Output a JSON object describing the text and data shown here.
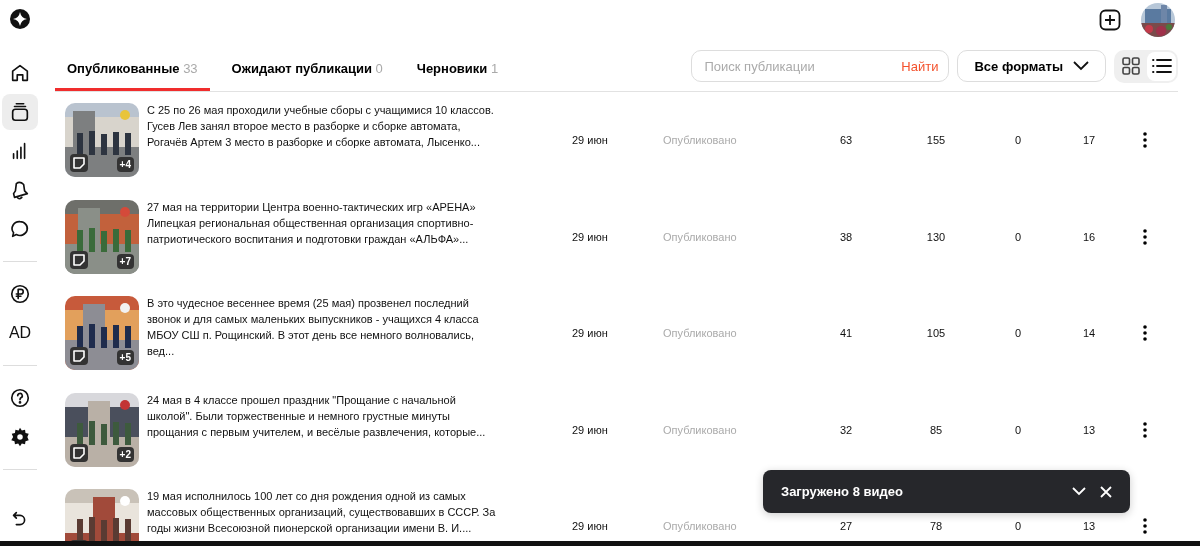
{
  "sidebar": {
    "groups": [
      {
        "items": [
          {
            "kind": "home",
            "selected": false
          },
          {
            "kind": "posts",
            "selected": true
          },
          {
            "kind": "stats",
            "selected": false
          },
          {
            "kind": "bell",
            "selected": false
          },
          {
            "kind": "chat",
            "selected": false
          }
        ]
      },
      {
        "items": [
          {
            "kind": "ruble",
            "selected": false
          },
          {
            "kind": "text",
            "label": "AD",
            "selected": false
          }
        ]
      },
      {
        "items": [
          {
            "kind": "help",
            "selected": false
          },
          {
            "kind": "settings",
            "selected": false
          }
        ]
      },
      {
        "items": [
          {
            "kind": "undo",
            "selected": false
          }
        ]
      }
    ]
  },
  "tabs": [
    {
      "label": "Опубликованные",
      "count": "33",
      "selected": true
    },
    {
      "label": "Ожидают публикации",
      "count": "0",
      "selected": false
    },
    {
      "label": "Черновики",
      "count": "1",
      "selected": false
    }
  ],
  "search": {
    "placeholder": "Поиск публикации",
    "button": "Найти"
  },
  "format_filter": {
    "label": "Все форматы"
  },
  "view_toggle": [
    {
      "kind": "grid",
      "selected": false
    },
    {
      "kind": "list",
      "selected": true
    }
  ],
  "rows": [
    {
      "extra": "+4",
      "text": "С 25 по 26 мая проходили учебные сборы с учащимися 10 классов. Гусев Лев занял второе место в разборке и сборке автомата, Рогачёв Артем 3 место в разборке и сборке автомата, Лысенко...",
      "date": "29 июн",
      "status": "Опубликовано",
      "stats": [
        "63",
        "155",
        "0",
        "17"
      ]
    },
    {
      "extra": "+7",
      "text": "27 мая на территории Центра военно-тактических игр «АРЕНА» Липецкая региональная общественная организация спортивно-патриотического воспитания и подготовки граждан «АЛЬФА»...",
      "date": "29 июн",
      "status": "Опубликовано",
      "stats": [
        "38",
        "130",
        "0",
        "16"
      ]
    },
    {
      "extra": "+5",
      "text": "В это чудесное весеннее время (25 мая) прозвенел последний звонок и для самых маленьких выпускников - учащихся 4 класса МБОУ СШ п. Рощинский. В этот день все немного волновались, вед...",
      "date": "29 июн",
      "status": "Опубликовано",
      "stats": [
        "41",
        "105",
        "0",
        "14"
      ]
    },
    {
      "extra": "+2",
      "text": "24 мая в 4 классе прошел праздник \"Прощание с начальной школой\". Были торжественные и немного грустные минуты прощания с первым учителем, и весёлые развлечения, которые...",
      "date": "29 июн",
      "status": "Опубликовано",
      "stats": [
        "32",
        "85",
        "0",
        "13"
      ]
    },
    {
      "text": "19 мая исполнилось 100 лет со дня рождения одной из самых массовых общественных организаций, существовавших в СССР. За годы жизни Всесоюзной пионерской организации имени В. И....",
      "date": "29 июн",
      "status": "Опубликовано",
      "stats": [
        "27",
        "78",
        "0",
        "13"
      ]
    }
  ],
  "toast": {
    "message": "Загружено 8 видео"
  }
}
